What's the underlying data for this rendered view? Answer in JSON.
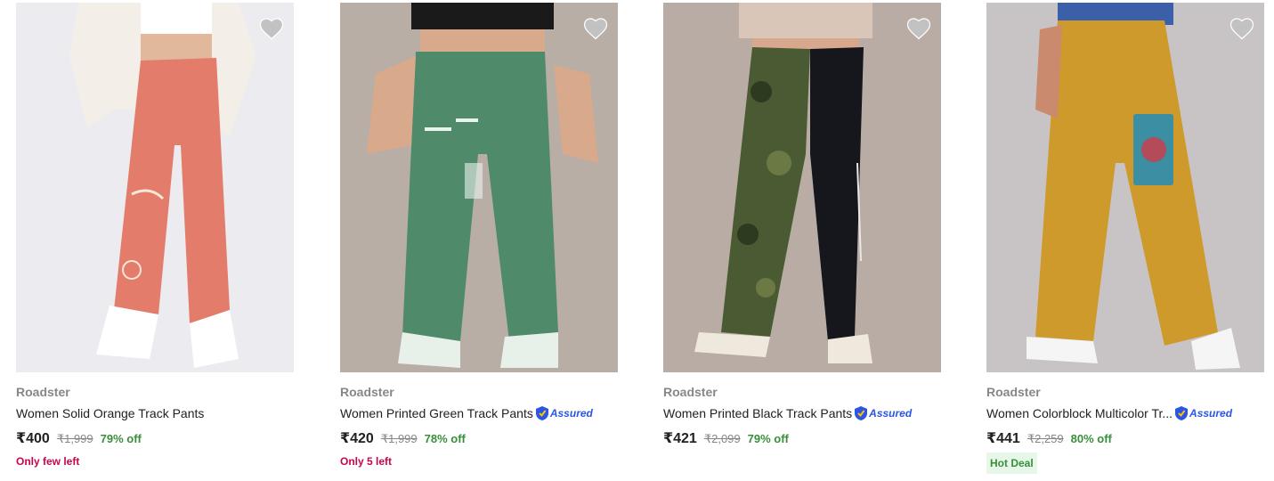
{
  "products": [
    {
      "brand": "Roadster",
      "title": "Women Solid Orange Track Pants",
      "price": "₹400",
      "mrp": "₹1,999",
      "discount": "79% off",
      "stock_note": "Only few left",
      "assured": false,
      "colors": {
        "bg": "#e9e9ee",
        "pant": "#e57b6a",
        "top": "#f2ede6"
      }
    },
    {
      "brand": "Roadster",
      "title": "Women Printed Green Track Pants",
      "price": "₹420",
      "mrp": "₹1,999",
      "discount": "78% off",
      "stock_note": "Only 5 left",
      "assured": true,
      "assured_label": "Assured",
      "colors": {
        "bg": "#b8aea6",
        "pant": "#4f8a6a",
        "top": "#1a1a1a"
      }
    },
    {
      "brand": "Roadster",
      "title": "Women Printed Black Track Pants",
      "price": "₹421",
      "mrp": "₹2,099",
      "discount": "79% off",
      "assured": true,
      "assured_label": "Assured",
      "colors": {
        "bg": "#b9aca4",
        "pant": "#15171c",
        "camo": "#4a5a32",
        "top": "#d9c6b8"
      }
    },
    {
      "brand": "Roadster",
      "title": "Women Colorblock Multicolor Tr...",
      "price": "₹441",
      "mrp": "₹2,259",
      "discount": "80% off",
      "deal_badge": "Hot Deal",
      "assured": true,
      "assured_label": "Assured",
      "colors": {
        "bg": "#c8c4c6",
        "pant": "#cf9a2c",
        "top": "#3b5fa8"
      }
    }
  ],
  "icons": {
    "wishlist": "heart-icon",
    "assured": "assured-shield-icon"
  },
  "theme": {
    "accent_green": "#388e3c",
    "stock_red": "#c7054f",
    "assured_blue": "#2a55e5"
  }
}
